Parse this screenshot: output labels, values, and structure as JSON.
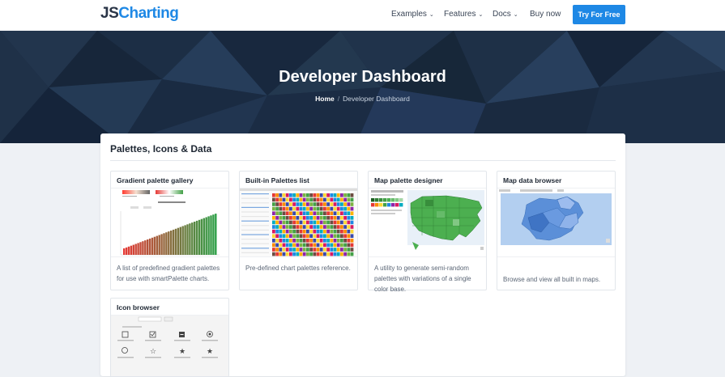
{
  "nav": {
    "logo_js": "JS",
    "logo_charting": "Charting",
    "items": [
      {
        "label": "Examples"
      },
      {
        "label": "Features"
      },
      {
        "label": "Docs"
      },
      {
        "label": "Buy now"
      }
    ],
    "cta_label": "Try For Free"
  },
  "hero": {
    "title": "Developer Dashboard",
    "breadcrumb_home": "Home",
    "breadcrumb_current": "Developer Dashboard"
  },
  "section": {
    "title": "Palettes, Icons & Data",
    "cards": [
      {
        "title": "Gradient palette gallery",
        "description": "A list of predefined gradient palettes for use with smartPalette charts."
      },
      {
        "title": "Built-in Palettes list",
        "description": "Pre-defined chart palettes reference."
      },
      {
        "title": "Map palette designer",
        "description": "A utility to generate semi-random palettes with variations of a single color base."
      },
      {
        "title": "Map data browser",
        "description": "Browse and view all built in maps."
      },
      {
        "title": "Icon browser",
        "description": ""
      }
    ]
  },
  "colors": {
    "accent": "#1e88e5",
    "hero_bg": "#1a2a3e",
    "text_dark": "#1e2733",
    "text_muted": "#5b6676"
  }
}
